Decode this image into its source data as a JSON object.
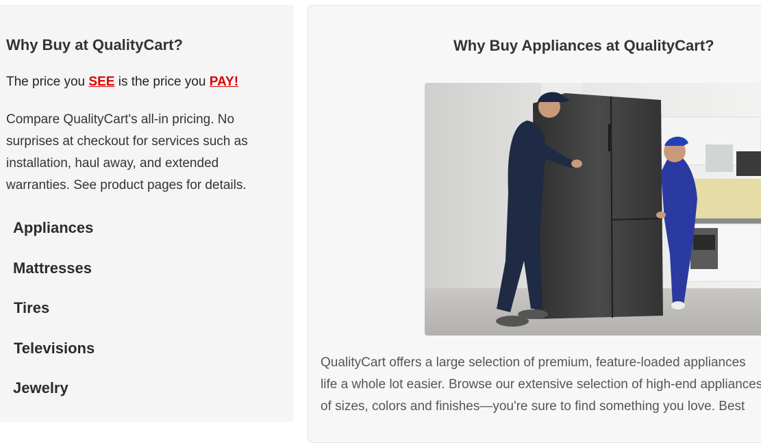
{
  "sidebar": {
    "title": "Why Buy at QualityCart?",
    "price_prefix": "The price you ",
    "price_see": "SEE",
    "price_middle": " is the price you ",
    "price_pay": "PAY!",
    "description": "Compare QualityCart's all-in pricing. No surprises at checkout for services such as installation, haul away, and extended warranties. See product pages for details.",
    "categories": [
      "Appliances",
      "Mattresses",
      "Tires",
      "Televisions",
      "Jewelry"
    ]
  },
  "main": {
    "title": "Why Buy Appliances at QualityCart?",
    "image_alt": "Two workers in blue uniforms moving a black side-by-side refrigerator in a kitchen",
    "text_lines": [
      "QualityCart offers a large selection of premium, feature-loaded appliances",
      "life a whole lot easier. Browse our extensive selection of high-end appliances",
      "of sizes, colors and finishes—you're sure to find something you love. Best"
    ]
  }
}
